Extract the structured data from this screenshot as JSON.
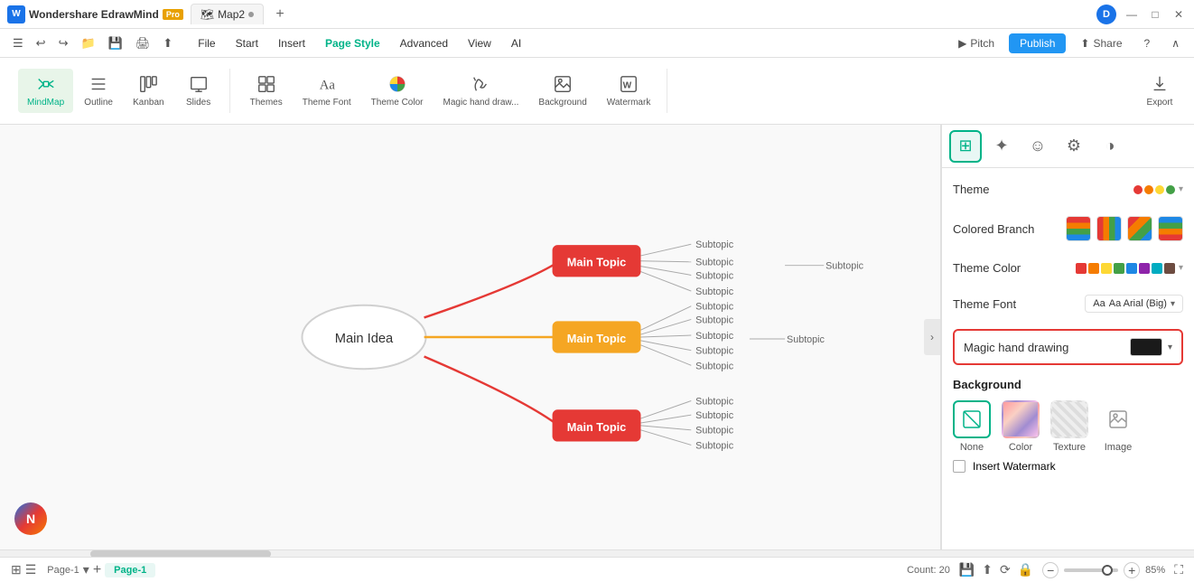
{
  "app": {
    "logo_text": "Wondershare EdrawMind",
    "logo_letter": "W",
    "pro_badge": "Pro",
    "tab_name": "Map2",
    "avatar_letter": "D"
  },
  "title_bar": {
    "win_minimize": "—",
    "win_maximize": "□",
    "win_close": "✕"
  },
  "menu": {
    "items": [
      {
        "label": "File"
      },
      {
        "label": "Start"
      },
      {
        "label": "Insert"
      },
      {
        "label": "Page Style",
        "active": true
      },
      {
        "label": "Advanced"
      },
      {
        "label": "View"
      },
      {
        "label": "AI"
      }
    ],
    "actions": [
      {
        "label": "Pitch",
        "icon": "▶"
      },
      {
        "label": "Publish",
        "type": "publish"
      },
      {
        "label": "Share",
        "icon": "⬆"
      }
    ]
  },
  "toolbar": {
    "groups": [
      {
        "items": [
          {
            "label": "MindMap",
            "icon": "mindmap",
            "active": true
          },
          {
            "label": "Outline",
            "icon": "outline"
          },
          {
            "label": "Kanban",
            "icon": "kanban"
          },
          {
            "label": "Slides",
            "icon": "slides"
          }
        ]
      },
      {
        "items": [
          {
            "label": "Themes",
            "icon": "themes"
          },
          {
            "label": "Theme Font",
            "icon": "font"
          },
          {
            "label": "Theme Color",
            "icon": "color"
          },
          {
            "label": "Magic hand draw...",
            "icon": "magic"
          },
          {
            "label": "Background",
            "icon": "background"
          },
          {
            "label": "Watermark",
            "icon": "watermark"
          }
        ]
      }
    ],
    "export_label": "Export"
  },
  "panel": {
    "tabs": [
      {
        "icon": "⊞",
        "active": true,
        "name": "style"
      },
      {
        "icon": "✦",
        "name": "ai"
      },
      {
        "icon": "☺",
        "name": "emoji"
      },
      {
        "icon": "⚙",
        "name": "settings"
      },
      {
        "icon": "◑",
        "name": "theme"
      }
    ],
    "theme_label": "Theme",
    "colored_branch_label": "Colored Branch",
    "theme_color_label": "Theme Color",
    "theme_font_label": "Theme Font",
    "theme_font_value": "Aa Arial (Big)",
    "magic_hand_label": "Magic hand drawing",
    "background_section_label": "Background",
    "background_options": [
      {
        "label": "None",
        "active": true
      },
      {
        "label": "Color"
      },
      {
        "label": "Texture"
      },
      {
        "label": "Image"
      }
    ],
    "watermark_label": "Insert Watermark",
    "colors": [
      "#e53935",
      "#f57c00",
      "#fdd835",
      "#43a047",
      "#1e88e5",
      "#8e24aa",
      "#00acc1",
      "#6d4c41"
    ]
  },
  "mindmap": {
    "center_label": "Main Idea",
    "topics": [
      {
        "label": "Main Topic",
        "color": "#e53935",
        "subtopics": [
          "Subtopic",
          "Subtopic",
          "Subtopic",
          "Subtopic"
        ]
      },
      {
        "label": "Main Topic",
        "color": "#f5a623",
        "subtopics": [
          "Subtopic",
          "Subtopic",
          "Subtopic",
          "Subtopic",
          "Subtopic"
        ]
      },
      {
        "label": "Main Topic",
        "color": "#e53935",
        "subtopics": [
          "Subtopic",
          "Subtopic",
          "Subtopic",
          "Subtopic"
        ]
      }
    ],
    "extra_subtopics": [
      "Subtopic"
    ]
  },
  "status_bar": {
    "page_label": "Page-1",
    "page_current": "Page-1",
    "count_label": "Count: 20",
    "zoom_percent": "85%"
  }
}
